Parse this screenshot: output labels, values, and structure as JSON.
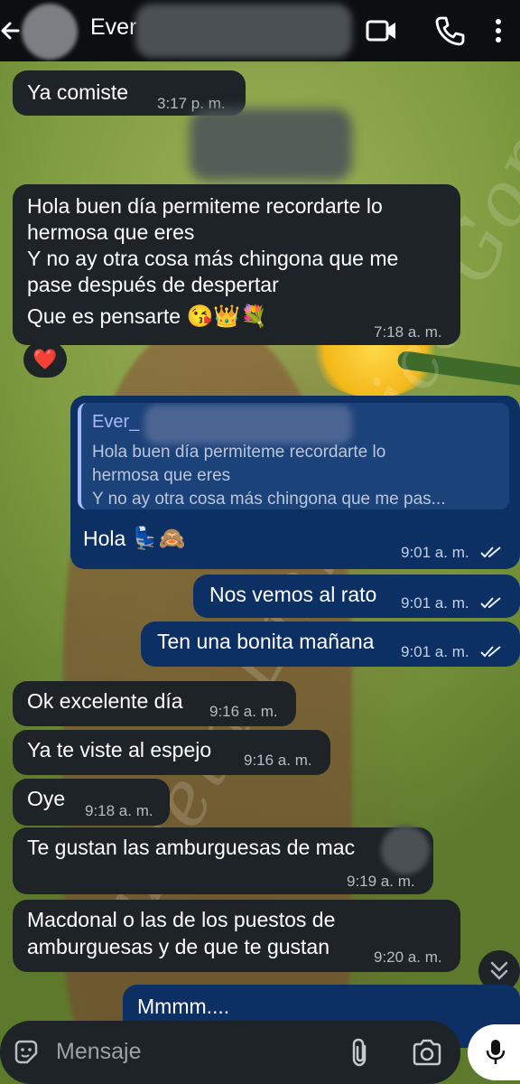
{
  "header": {
    "contact_name": "Ever",
    "icons": [
      "back-arrow-icon",
      "video-call-icon",
      "phone-call-icon",
      "more-options-icon"
    ]
  },
  "messages": [
    {
      "type": "incoming",
      "text": "Ya comiste",
      "time": "3:17 p. m."
    },
    {
      "type": "incoming",
      "lines": [
        "Hola buen día permiteme recordarte lo",
        "hermosa que eres",
        "Y no ay otra cosa más chingona que me",
        "pase después de despertar"
      ],
      "last_line": "Que es pensarte",
      "emojis": "😘👑💐",
      "time": "7:18 a. m.",
      "reaction": "❤️"
    },
    {
      "type": "outgoing",
      "reply_to": {
        "name": "Ever_",
        "lines": [
          "Hola buen día permiteme recordarte lo",
          "hermosa que eres",
          "Y no ay otra cosa más chingona que me pas..."
        ]
      },
      "text": "Hola",
      "emojis": "💺🙈",
      "time": "9:01 a. m."
    },
    {
      "type": "outgoing",
      "text": "Nos vemos al rato",
      "time": "9:01 a. m."
    },
    {
      "type": "outgoing",
      "text": "Ten una bonita mañana",
      "time": "9:01 a. m."
    },
    {
      "type": "incoming",
      "text": "Ok excelente día",
      "time": "9:16 a. m."
    },
    {
      "type": "incoming",
      "text": "Ya te viste al espejo",
      "time": "9:16 a. m."
    },
    {
      "type": "incoming",
      "text": "Oye",
      "time": "9:18 a. m."
    },
    {
      "type": "incoming",
      "text": "Te gustan las amburguesas de mac",
      "time": "9:19 a. m."
    },
    {
      "type": "incoming",
      "lines": [
        "Macdonal o las de los puestos de",
        "amburguesas y de que te gustan"
      ],
      "time": "9:20 a. m."
    },
    {
      "type": "outgoing",
      "text": "Mmmm...."
    }
  ],
  "composer": {
    "placeholder": "Mensaje"
  },
  "watermark": "Julieta Emily Pico Gomez",
  "colors": {
    "header_bg": "#0b0f12",
    "incoming_bubble": "#1d2327",
    "outgoing_bubble": "#0c3063",
    "reply_accent": "#a9b8ff"
  }
}
